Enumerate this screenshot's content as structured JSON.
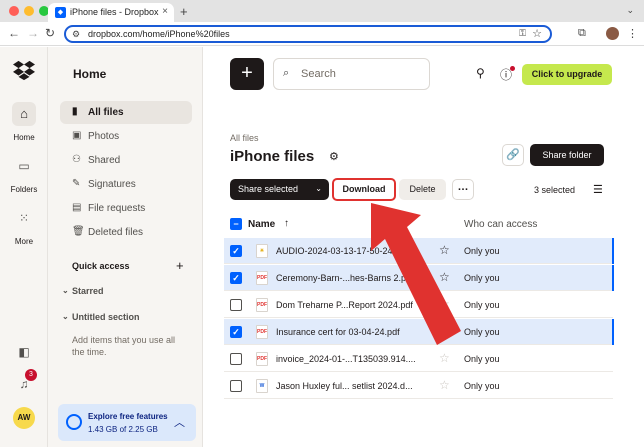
{
  "browser": {
    "tab_title": "iPhone files - Dropbox",
    "url": "dropbox.com/home/iPhone%20files"
  },
  "rail": {
    "items": [
      {
        "label": "Home",
        "icon": "home-icon"
      },
      {
        "label": "Folders",
        "icon": "folder-icon"
      },
      {
        "label": "More",
        "icon": "grid-icon"
      }
    ],
    "notification_count": "3",
    "avatar_initials": "AW"
  },
  "sidebar": {
    "title": "Home",
    "items": [
      {
        "label": "All files",
        "icon": "files-icon",
        "active": true
      },
      {
        "label": "Photos",
        "icon": "photos-icon"
      },
      {
        "label": "Shared",
        "icon": "shared-icon"
      },
      {
        "label": "Signatures",
        "icon": "signature-icon"
      },
      {
        "label": "File requests",
        "icon": "file-request-icon"
      },
      {
        "label": "Deleted files",
        "icon": "trash-icon"
      }
    ],
    "quick_access": "Quick access",
    "sections": [
      "Starred",
      "Untitled section"
    ],
    "hint": "Add items that you use all the time.",
    "storage": {
      "title": "Explore free features",
      "usage": "1.43 GB of 2.25 GB"
    }
  },
  "header": {
    "search_placeholder": "Search",
    "upgrade_label": "Click to upgrade"
  },
  "page": {
    "breadcrumb": "All files",
    "title": "iPhone files",
    "share_folder_label": "Share folder"
  },
  "actions": {
    "share_selected": "Share selected",
    "download": "Download",
    "delete": "Delete",
    "selected_count": "3 selected"
  },
  "table": {
    "col_name": "Name",
    "col_access": "Who can access",
    "rows": [
      {
        "name": "AUDIO-2024-03-13-17-50-24",
        "access": "Only you",
        "selected": true,
        "type": "audio"
      },
      {
        "name": "Ceremony-Barn-...hes-Barns 2.pdf",
        "access": "Only you",
        "selected": true,
        "type": "pdf"
      },
      {
        "name": "Dom Treharne P...Report 2024.pdf",
        "access": "Only you",
        "selected": false,
        "type": "pdf"
      },
      {
        "name": "Insurance cert for 03-04-24.pdf",
        "access": "Only you",
        "selected": true,
        "type": "pdf"
      },
      {
        "name": "invoice_2024-01-...T135039.914....",
        "access": "Only you",
        "selected": false,
        "type": "pdf"
      },
      {
        "name": "Jason Huxley ful... setlist 2024.d...",
        "access": "Only you",
        "selected": false,
        "type": "doc"
      }
    ]
  },
  "colors": {
    "accent": "#0061fe",
    "upgrade": "#c5e84d",
    "highlight": "#e0322f",
    "row_selected": "#e1ebfb"
  }
}
